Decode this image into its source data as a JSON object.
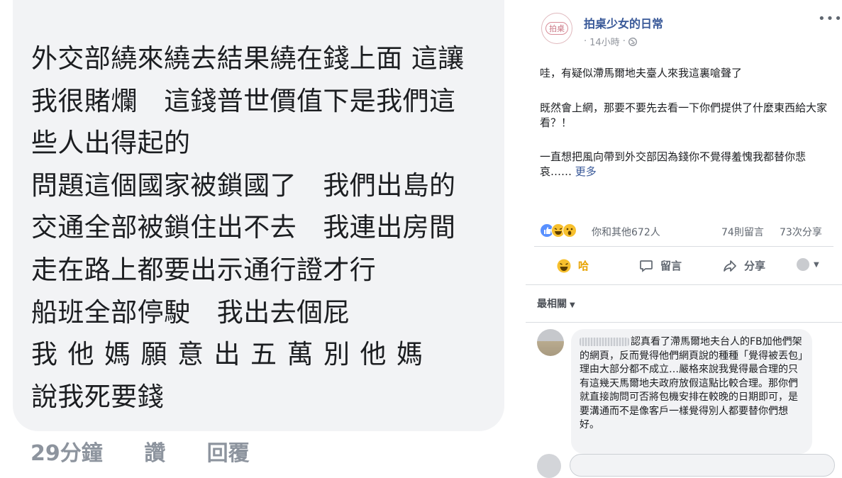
{
  "left_comment": {
    "lines": [
      "外交部繞來繞去結果繞在錢上面 這讓",
      "我很賭爛　這錢普世價值下是我們這",
      "些人出得起的",
      "問題這個國家被鎖國了　我們出島的",
      "交通全部被鎖住出不去　我連出房間",
      "走在路上都要出示通行證才行",
      "船班全部停駛　我出去個屁",
      "我他媽願意出五萬別他媽",
      "說我死要錢"
    ],
    "time": "29分鐘",
    "like_label": "讚",
    "reply_label": "回覆"
  },
  "post": {
    "page_name": "拍桌少女的日常",
    "avatar_text": "拍桌",
    "time": "14小時",
    "separator": "·",
    "paragraphs": [
      "哇，有疑似滯馬爾地夫臺人來我這裏嗆聲了",
      "既然會上網，那要不要先去看一下你們提供了什麼東西給大家看？！",
      "一直想把風向帶到外交部因為錢你不覺得羞愧我都替你悲哀……"
    ],
    "more_label": "更多",
    "reactions_text": "你和其他672人",
    "comments_count": "74則留言",
    "shares_count": "73次分享",
    "actions": {
      "haha": "哈",
      "comment": "留言",
      "share": "分享"
    },
    "sort_label": "最相關",
    "comment": {
      "text": "認真看了滯馬爾地夫台人的FB加他們架的網頁，反而覺得他們網頁說的種種「覺得被丟包」理由大部分都不成立…嚴格來說我覺得最合理的只有這幾天馬爾地夫政府放假這點比較合理。那你們就直接詢問可否將包機安排在較晚的日期即可，是要溝通而不是像客戶一樣覺得別人都要替你們想好。"
    }
  },
  "colors": {
    "link": "#385898",
    "bubble": "#f2f3f5",
    "muted": "#8d949e",
    "haha": "#e8a300"
  },
  "icons": [
    "more-icon",
    "globe-icon",
    "like-icon",
    "haha-icon",
    "wow-icon",
    "comment-icon",
    "share-icon",
    "chevron-down-icon"
  ]
}
